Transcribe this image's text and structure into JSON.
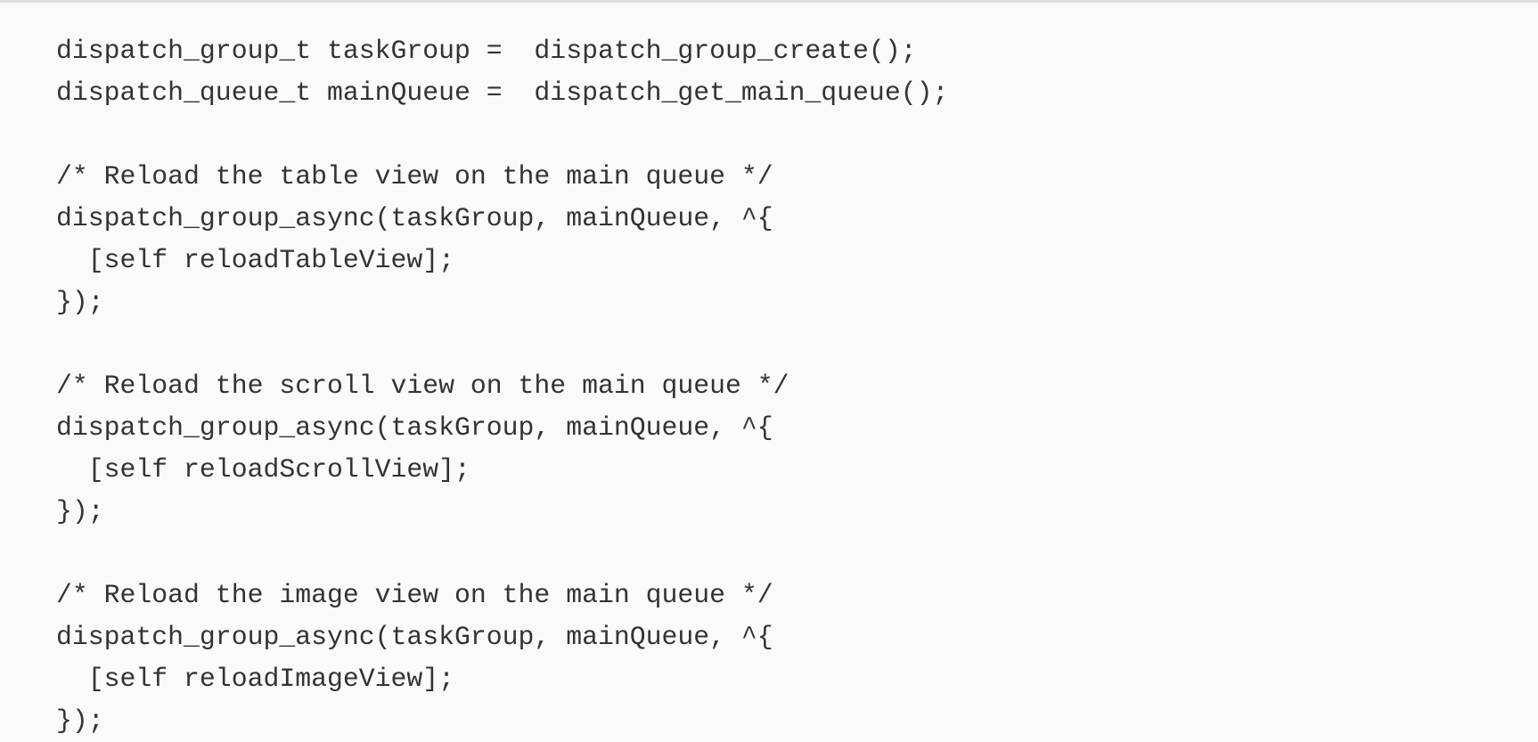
{
  "code": {
    "language": "objective-c",
    "lines": [
      "dispatch_group_t taskGroup =  dispatch_group_create();",
      "dispatch_queue_t mainQueue =  dispatch_get_main_queue();",
      "",
      "/* Reload the table view on the main queue */",
      "dispatch_group_async(taskGroup, mainQueue, ^{",
      "  [self reloadTableView];",
      "});",
      "",
      "/* Reload the scroll view on the main queue */",
      "dispatch_group_async(taskGroup, mainQueue, ^{",
      "  [self reloadScrollView];",
      "});",
      "",
      "/* Reload the image view on the main queue */",
      "dispatch_group_async(taskGroup, mainQueue, ^{",
      "  [self reloadImageView];",
      "});"
    ]
  },
  "colors": {
    "background": "#fafafa",
    "text": "#333333",
    "border": "#dcdcdc"
  }
}
